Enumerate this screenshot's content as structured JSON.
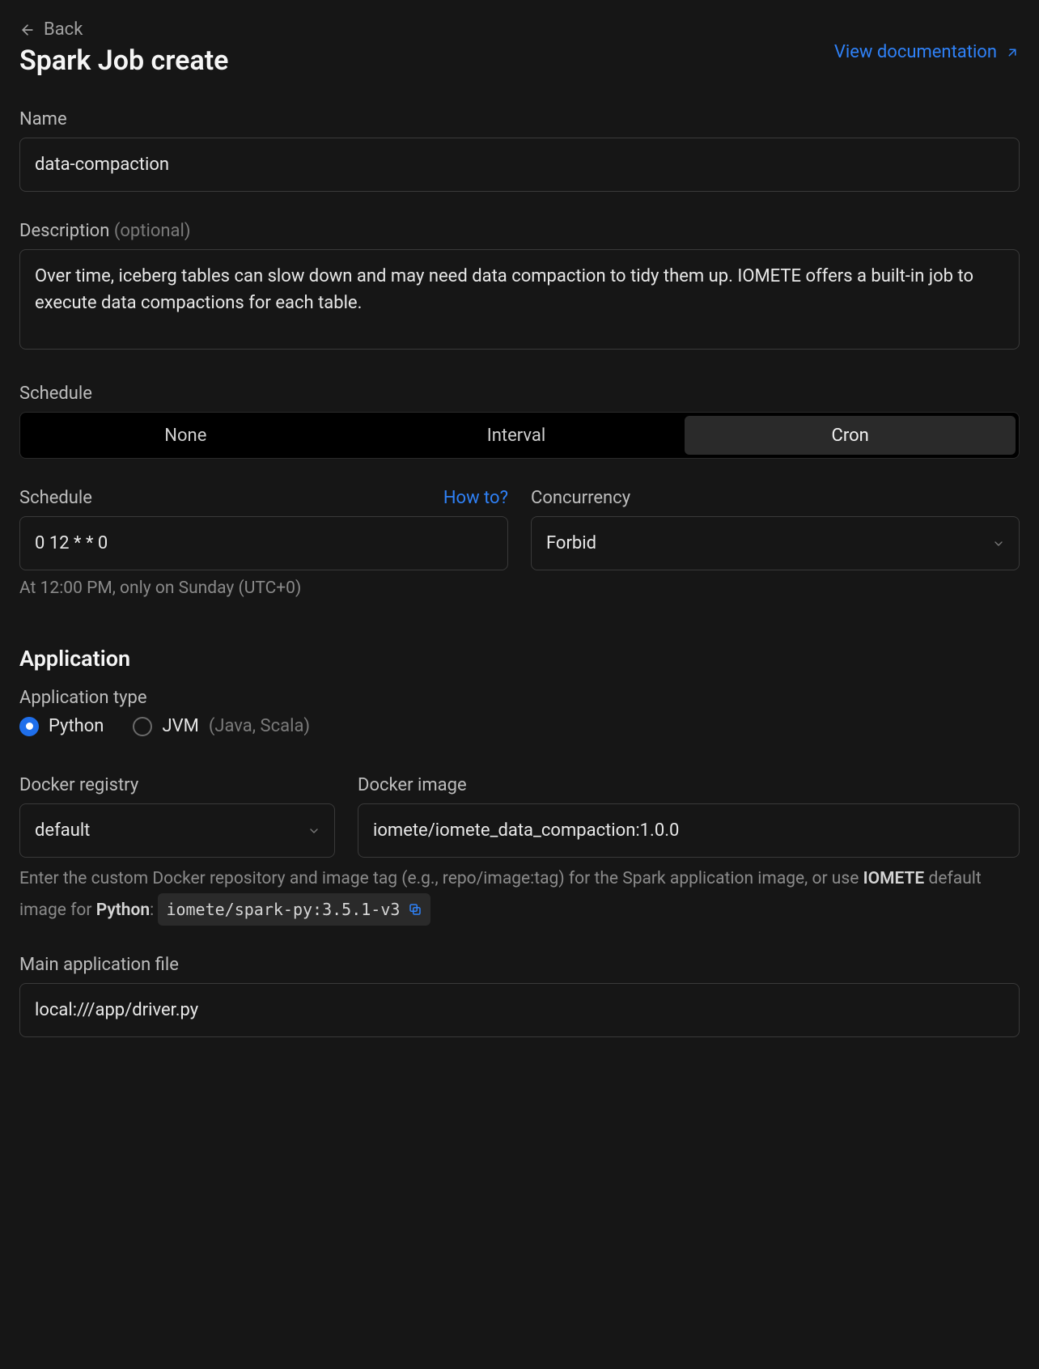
{
  "header": {
    "back_label": "Back",
    "title": "Spark Job create",
    "doc_link": "View documentation"
  },
  "name": {
    "label": "Name",
    "value": "data-compaction"
  },
  "description": {
    "label": "Description",
    "label_suffix": "(optional)",
    "value": "Over time, iceberg tables can slow down and may need data compaction to tidy them up. IOMETE offers a built-in job to execute data compactions for each table."
  },
  "schedule_type": {
    "label": "Schedule",
    "options": [
      "None",
      "Interval",
      "Cron"
    ],
    "selected": "Cron"
  },
  "schedule": {
    "label": "Schedule",
    "how_to": "How to?",
    "value": "0 12 * * 0",
    "helper": "At 12:00 PM, only on Sunday (UTC+0)"
  },
  "concurrency": {
    "label": "Concurrency",
    "value": "Forbid"
  },
  "application": {
    "title": "Application",
    "type_label": "Application type",
    "options": {
      "python": "Python",
      "jvm_label": "JVM",
      "jvm_suffix": "(Java, Scala)"
    },
    "selected": "python"
  },
  "docker": {
    "registry_label": "Docker registry",
    "registry_value": "default",
    "image_label": "Docker image",
    "image_value": "iomete/iomete_data_compaction:1.0.0",
    "help_prefix": "Enter the custom Docker repository and image tag (e.g., repo/image:tag) for the Spark application image, or use ",
    "help_brand": "IOMETE",
    "help_mid": " default image for ",
    "help_lang": "Python",
    "help_colon": ": ",
    "default_image": "iomete/spark-py:3.5.1-v3"
  },
  "main_file": {
    "label": "Main application file",
    "value": "local:///app/driver.py"
  }
}
